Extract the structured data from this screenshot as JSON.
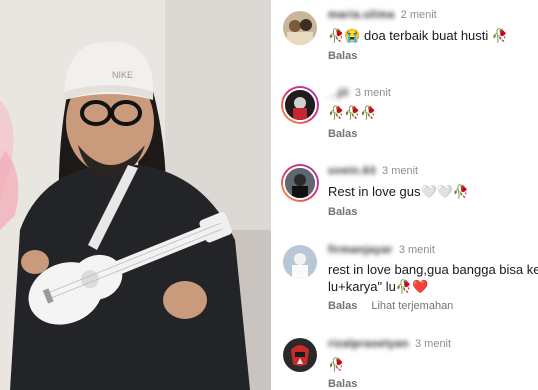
{
  "photo": {
    "hat_text": "NIKE"
  },
  "comments": [
    {
      "username": "maria.ulima",
      "time": "2 menit",
      "text": "🥀😭 doa terbaik buat husti 🥀",
      "reply": "Balas"
    },
    {
      "username": "_.jii",
      "time": "3 menit",
      "text": "🥀🥀🥀",
      "reply": "Balas"
    },
    {
      "username": "uvein.63",
      "time": "3 menit",
      "text": "Rest in love gus🤍🤍🥀",
      "reply": "Balas"
    },
    {
      "username": "firmanjayar",
      "time": "3 menit",
      "text_line1": "rest in love bang,gua bangga bisa ke",
      "text_line2": "lu+karya\" lu🥀❤️",
      "reply": "Balas",
      "translate": "Lihat terjemahan"
    },
    {
      "username": "rizalprasetyan",
      "time": "3 menit",
      "text": "🥀",
      "reply": "Balas"
    }
  ]
}
